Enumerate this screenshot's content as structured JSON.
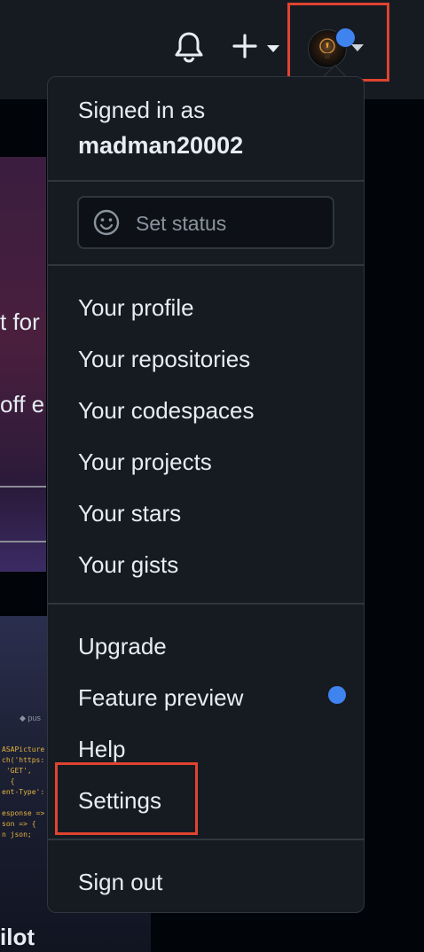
{
  "header": {
    "notifications_icon": "bell-icon",
    "create_icon": "plus-icon",
    "avatar_icon": "user-avatar"
  },
  "background": {
    "card_text_1": "t for",
    "card_text_2": "off e",
    "code_snippet": "ASAPicture\nch('https:\n 'GET',\n  {\nent-Type':\n\nesponse =>\nson => {\nn json;",
    "code_tab": "◆ pus",
    "bottom_text": "ilot"
  },
  "menu": {
    "signed_in_label": "Signed in as",
    "username": "madman20002",
    "set_status": "Set status",
    "items": [
      "Your profile",
      "Your repositories",
      "Your codespaces",
      "Your projects",
      "Your stars",
      "Your gists"
    ],
    "upgrade": "Upgrade",
    "feature_preview": "Feature preview",
    "help": "Help",
    "settings": "Settings",
    "sign_out": "Sign out"
  },
  "colors": {
    "accent_dot": "#3f83ef",
    "highlight": "#e0432f",
    "menu_bg": "#161b22"
  }
}
